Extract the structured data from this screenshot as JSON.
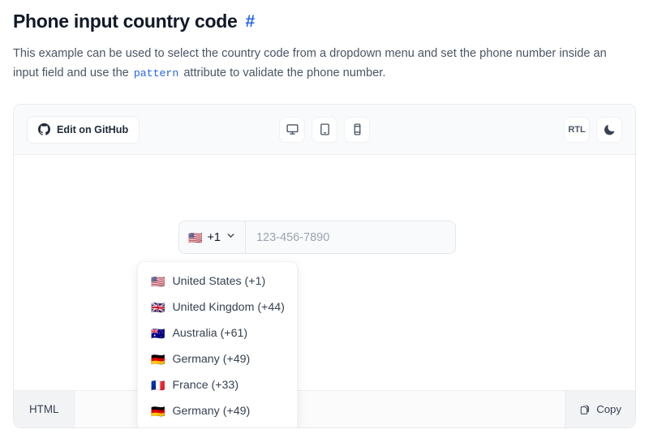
{
  "header": {
    "title": "Phone input country code",
    "anchor": "#",
    "description_part1": "This example can be used to select the country code from a dropdown menu and set the phone number inside an input field and use the ",
    "description_code": "pattern",
    "description_part2": " attribute to validate the phone number."
  },
  "toolbar": {
    "github_label": "Edit on GitHub",
    "github_icon": "github-icon",
    "devices": [
      {
        "name": "desktop",
        "icon": "desktop-icon"
      },
      {
        "name": "tablet",
        "icon": "tablet-icon"
      },
      {
        "name": "mobile",
        "icon": "mobile-icon"
      }
    ],
    "rtl_label": "RTL",
    "theme_icon": "moon-icon"
  },
  "preview": {
    "country_button": {
      "flag": "🇺🇸",
      "code": "+1",
      "chevron_icon": "chevron-down-icon"
    },
    "phone_input": {
      "value": "",
      "placeholder": "123-456-7890"
    },
    "dropdown": {
      "items": [
        {
          "flag": "🇺🇸",
          "label": "United States (+1)"
        },
        {
          "flag": "🇬🇧",
          "label": "United Kingdom (+44)"
        },
        {
          "flag": "🇦🇺",
          "label": "Australia (+61)"
        },
        {
          "flag": "🇩🇪",
          "label": "Germany (+49)"
        },
        {
          "flag": "🇫🇷",
          "label": "France (+33)"
        },
        {
          "flag": "🇩🇪",
          "label": "Germany (+49)"
        }
      ]
    }
  },
  "code_bar": {
    "tab_label": "HTML",
    "copy_label": "Copy",
    "copy_icon": "copy-icon"
  },
  "colors": {
    "accent": "#2563eb",
    "text": "#111827",
    "muted": "#4b5563",
    "border": "#e9eaee",
    "surface": "#f9fafb"
  }
}
